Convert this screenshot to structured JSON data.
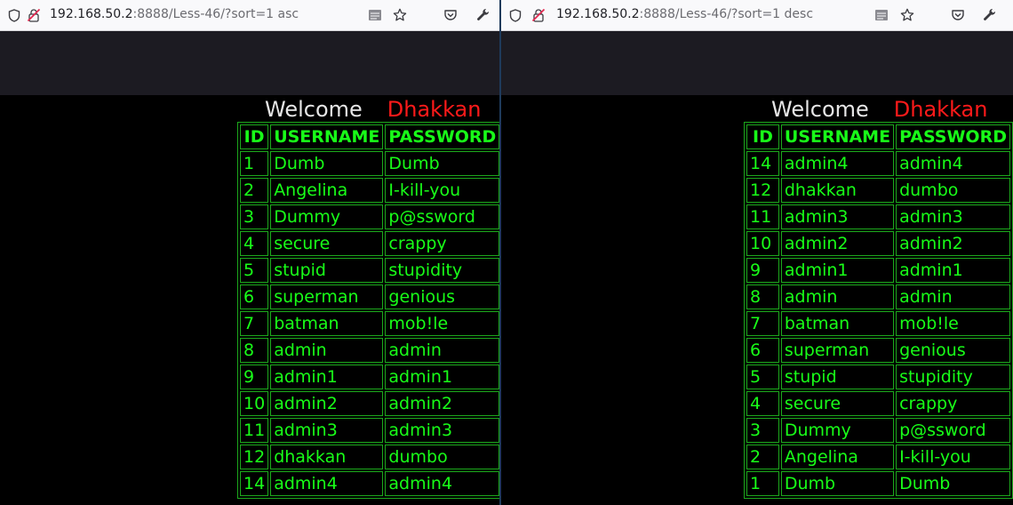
{
  "left": {
    "url": {
      "host": "192.168.50.2",
      "rest": ":8888/Less-46/?sort=1 asc"
    },
    "welcome": "Welcome",
    "name": "Dhakkan",
    "headers": [
      "ID",
      "USERNAME",
      "PASSWORD"
    ],
    "rows": [
      [
        "1",
        "Dumb",
        "Dumb"
      ],
      [
        "2",
        "Angelina",
        "I-kill-you"
      ],
      [
        "3",
        "Dummy",
        "p@ssword"
      ],
      [
        "4",
        "secure",
        "crappy"
      ],
      [
        "5",
        "stupid",
        "stupidity"
      ],
      [
        "6",
        "superman",
        "genious"
      ],
      [
        "7",
        "batman",
        "mob!le"
      ],
      [
        "8",
        "admin",
        "admin"
      ],
      [
        "9",
        "admin1",
        "admin1"
      ],
      [
        "10",
        "admin2",
        "admin2"
      ],
      [
        "11",
        "admin3",
        "admin3"
      ],
      [
        "12",
        "dhakkan",
        "dumbo"
      ],
      [
        "14",
        "admin4",
        "admin4"
      ]
    ]
  },
  "right": {
    "url": {
      "host": "192.168.50.2",
      "rest": ":8888/Less-46/?sort=1 desc"
    },
    "welcome": "Welcome",
    "name": "Dhakkan",
    "headers": [
      "ID",
      "USERNAME",
      "PASSWORD"
    ],
    "rows": [
      [
        "14",
        "admin4",
        "admin4"
      ],
      [
        "12",
        "dhakkan",
        "dumbo"
      ],
      [
        "11",
        "admin3",
        "admin3"
      ],
      [
        "10",
        "admin2",
        "admin2"
      ],
      [
        "9",
        "admin1",
        "admin1"
      ],
      [
        "8",
        "admin",
        "admin"
      ],
      [
        "7",
        "batman",
        "mob!le"
      ],
      [
        "6",
        "superman",
        "genious"
      ],
      [
        "5",
        "stupid",
        "stupidity"
      ],
      [
        "4",
        "secure",
        "crappy"
      ],
      [
        "3",
        "Dummy",
        "p@ssword"
      ],
      [
        "2",
        "Angelina",
        "I-kill-you"
      ],
      [
        "1",
        "Dumb",
        "Dumb"
      ]
    ]
  },
  "icons": [
    "shield-icon",
    "insecure-lock-icon",
    "reader-view-icon",
    "bookmark-star-icon",
    "pocket-icon",
    "extensions-wrench-icon"
  ],
  "colors": {
    "welcome": "#e6e6e6",
    "name": "#ff1a1a",
    "table_text": "#18ff18",
    "table_border": "#1ca81c"
  }
}
